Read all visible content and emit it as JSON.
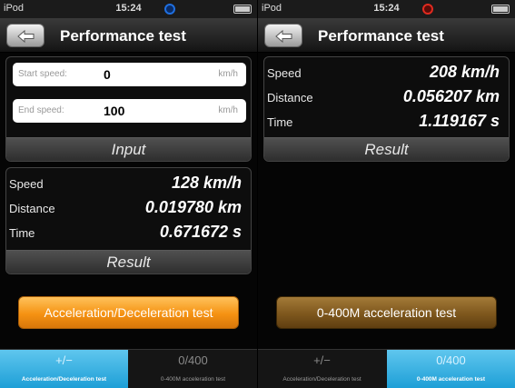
{
  "screens": [
    {
      "statusbar": {
        "carrier": "iPod",
        "time": "15:24",
        "indicator_color": "#1f6fe0"
      },
      "navbar": {
        "title": "Performance test"
      },
      "input_panel": {
        "start_speed": {
          "label": "Start speed:",
          "value": "0",
          "unit": "km/h"
        },
        "end_speed": {
          "label": "End speed:",
          "value": "100",
          "unit": "km/h"
        },
        "footer": "Input"
      },
      "result_panel": {
        "rows": [
          {
            "label": "Speed",
            "value": "128 km/h"
          },
          {
            "label": "Distance",
            "value": "0.019780 km"
          },
          {
            "label": "Time",
            "value": "0.671672 s"
          }
        ],
        "footer": "Result"
      },
      "action_button": "Acceleration/Deceleration test",
      "tabs": [
        {
          "icon": "+/−",
          "label": "Acceleration/Deceleration test",
          "active": true
        },
        {
          "icon": "0/400",
          "label": "0-400M acceleration test",
          "active": false
        }
      ]
    },
    {
      "statusbar": {
        "carrier": "iPod",
        "time": "15:24",
        "indicator_color": "#e02a1f"
      },
      "navbar": {
        "title": "Performance test"
      },
      "result_panel": {
        "rows": [
          {
            "label": "Speed",
            "value": "208 km/h"
          },
          {
            "label": "Distance",
            "value": "0.056207 km"
          },
          {
            "label": "Time",
            "value": "1.119167 s"
          }
        ],
        "footer": "Result"
      },
      "action_button": "0-400M acceleration test",
      "tabs": [
        {
          "icon": "+/−",
          "label": "Acceleration/Deceleration test",
          "active": false
        },
        {
          "icon": "0/400",
          "label": "0-400M acceleration test",
          "active": true
        }
      ]
    }
  ]
}
